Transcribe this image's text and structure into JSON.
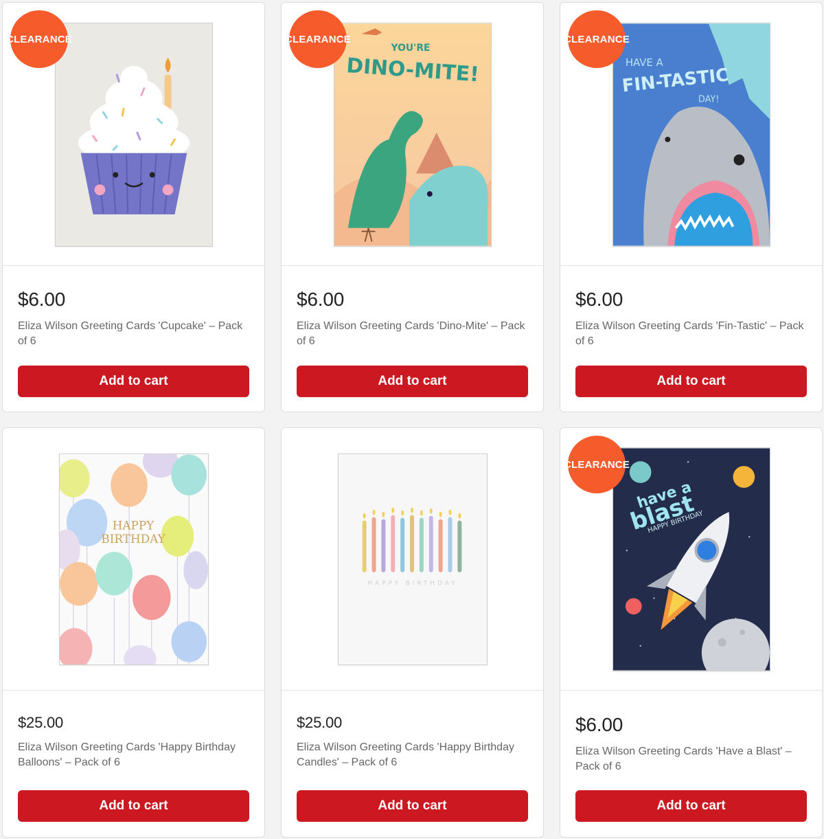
{
  "colors": {
    "badge": "#f65c2b",
    "button": "#cc1820"
  },
  "products": [
    {
      "name": "Eliza Wilson Greeting Cards 'Cupcake' – Pack of 6",
      "price": "$6.00",
      "badge": "CLEARANCE",
      "button": "Add to cart",
      "art": "cupcake-card-image"
    },
    {
      "name": "Eliza Wilson Greeting Cards 'Dino-Mite' – Pack of 6",
      "price": "$6.00",
      "badge": "CLEARANCE",
      "button": "Add to cart",
      "art": "dino-mite-card-image",
      "art_text": [
        "YOU'RE",
        "DINO-MITE!"
      ]
    },
    {
      "name": "Eliza Wilson Greeting Cards 'Fin-Tastic' – Pack of 6",
      "price": "$6.00",
      "badge": "CLEARANCE",
      "button": "Add to cart",
      "art": "shark-card-image",
      "art_text": [
        "HAVE A",
        "FIN-TASTIC",
        "DAY!"
      ]
    },
    {
      "name": "Eliza Wilson Greeting Cards 'Happy Birthday Balloons' – Pack of 6",
      "price": "$25.00",
      "button": "Add to cart",
      "art": "balloons-card-image",
      "art_text": [
        "HAPPY",
        "BIRTHDAY"
      ]
    },
    {
      "name": "Eliza Wilson Greeting Cards 'Happy Birthday Candles' – Pack of 6",
      "price": "$25.00",
      "button": "Add to cart",
      "art": "candles-card-image",
      "art_text": [
        "HAPPY BIRTHDAY"
      ]
    },
    {
      "name": "Eliza Wilson Greeting Cards 'Have a Blast' – Pack of 6",
      "price": "$6.00",
      "badge": "CLEARANCE",
      "button": "Add to cart",
      "art": "rocket-card-image",
      "art_text": [
        "have a",
        "blast",
        "HAPPY BIRTHDAY"
      ]
    }
  ]
}
